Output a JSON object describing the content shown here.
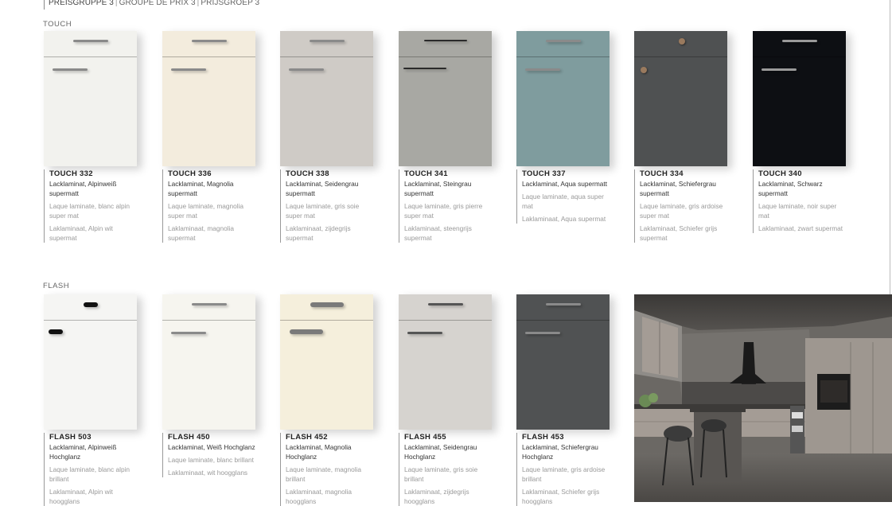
{
  "header": {
    "title": "PREISGRUPPE 3",
    "fr": "GROUPE DE PRIX 3",
    "nl": "PRIJSGROEP 3",
    "separator": "|"
  },
  "sections": [
    {
      "label": "TOUCH",
      "items": [
        {
          "name": "TOUCH 332",
          "de": "Lacklaminat, Alpinweiß supermatt",
          "fr": "Laque laminate, blanc alpin super mat",
          "nl": "Laklaminaat, Alpin wit supermat",
          "color": "#f2f2ee",
          "handle_color": "#8a8a8a",
          "handle": "bar"
        },
        {
          "name": "TOUCH 336",
          "de": "Lacklaminat, Magnolia supermatt",
          "fr": "Laque laminate, magnolia super mat",
          "nl": "Laklaminaat, magnolia supermat",
          "color": "#f3ecdd",
          "handle_color": "#8a8a8a",
          "handle": "bar"
        },
        {
          "name": "TOUCH 338",
          "de": "Lacklaminat, Seidengrau supermatt",
          "fr": "Laque laminate, gris soie super mat",
          "nl": "Laklaminaat, zijdegrijs supermat",
          "color": "#cfcbc6",
          "handle_color": "#8a8a8a",
          "handle": "bar"
        },
        {
          "name": "TOUCH 341",
          "de": "Lacklaminat, Steingrau supermatt",
          "fr": "Laque laminate, gris pierre super mat",
          "nl": "Laklaminaat, steengrijs supermat",
          "color": "#a8a8a3",
          "handle_color": "#2a2a2a",
          "handle": "bow"
        },
        {
          "name": "TOUCH 337",
          "de": "Lacklaminat, Aqua supermatt",
          "fr": "Laque laminate, aqua super mat",
          "nl": "Laklaminaat, Aqua supermat",
          "color": "#7f9c9e",
          "handle_color": "#8a8a8a",
          "handle": "bar"
        },
        {
          "name": "TOUCH 334",
          "de": "Lacklaminat, Schiefergrau supermatt",
          "fr": "Laque laminate, gris ardoise super mat",
          "nl": "Laklaminaat, Schiefer grijs supermat",
          "color": "#4f5152",
          "handle_color": "#9a7a5e",
          "handle": "knob"
        },
        {
          "name": "TOUCH 340",
          "de": "Lacklaminat, Schwarz supermatt",
          "fr": "Laque laminate, noir super mat",
          "nl": "Laklaminaat, zwart supermat",
          "color": "#0d0f13",
          "handle_color": "#9a9a9a",
          "handle": "bar"
        }
      ]
    },
    {
      "label": "FLASH",
      "items": [
        {
          "name": "FLASH 503",
          "de": "Lacklaminat, Alpinweiß Hochglanz",
          "fr": "Laque laminate, blanc alpin brillant",
          "nl": "Laklaminaat, Alpin wit hoogglans",
          "color": "#f5f5f3",
          "handle_color": "#111111",
          "handle": "pill"
        },
        {
          "name": "FLASH 450",
          "de": "Lacklaminat, Weiß Hochglanz",
          "fr": "Laque laminate, blanc brillant",
          "nl": "Laklaminaat, wit hoogglans",
          "color": "#f6f5ef",
          "handle_color": "#8a8a8a",
          "handle": "bar"
        },
        {
          "name": "FLASH 452",
          "de": "Lacklaminat, Magnolia Hochglanz",
          "fr": "Laque laminate, magnolia brillant",
          "nl": "Laklaminaat, magnolia hoogglans",
          "color": "#f5efdc",
          "handle_color": "#7a7a7a",
          "handle": "grip"
        },
        {
          "name": "FLASH 455",
          "de": "Lacklaminat, Seidengrau Hochglanz",
          "fr": "Laque laminate, gris soie brillant",
          "nl": "Laklaminaat, zijdegrijs hoogglans",
          "color": "#d6d3cf",
          "handle_color": "#555555",
          "handle": "bar"
        },
        {
          "name": "FLASH 453",
          "de": "Lacklaminat, Schiefergrau Hochglanz",
          "fr": "Laque laminate, gris ardoise brillant",
          "nl": "Laklaminaat, Schiefer grijs hoogglans",
          "color": "#505253",
          "handle_color": "#8a8a8a",
          "handle": "bar"
        }
      ]
    }
  ]
}
